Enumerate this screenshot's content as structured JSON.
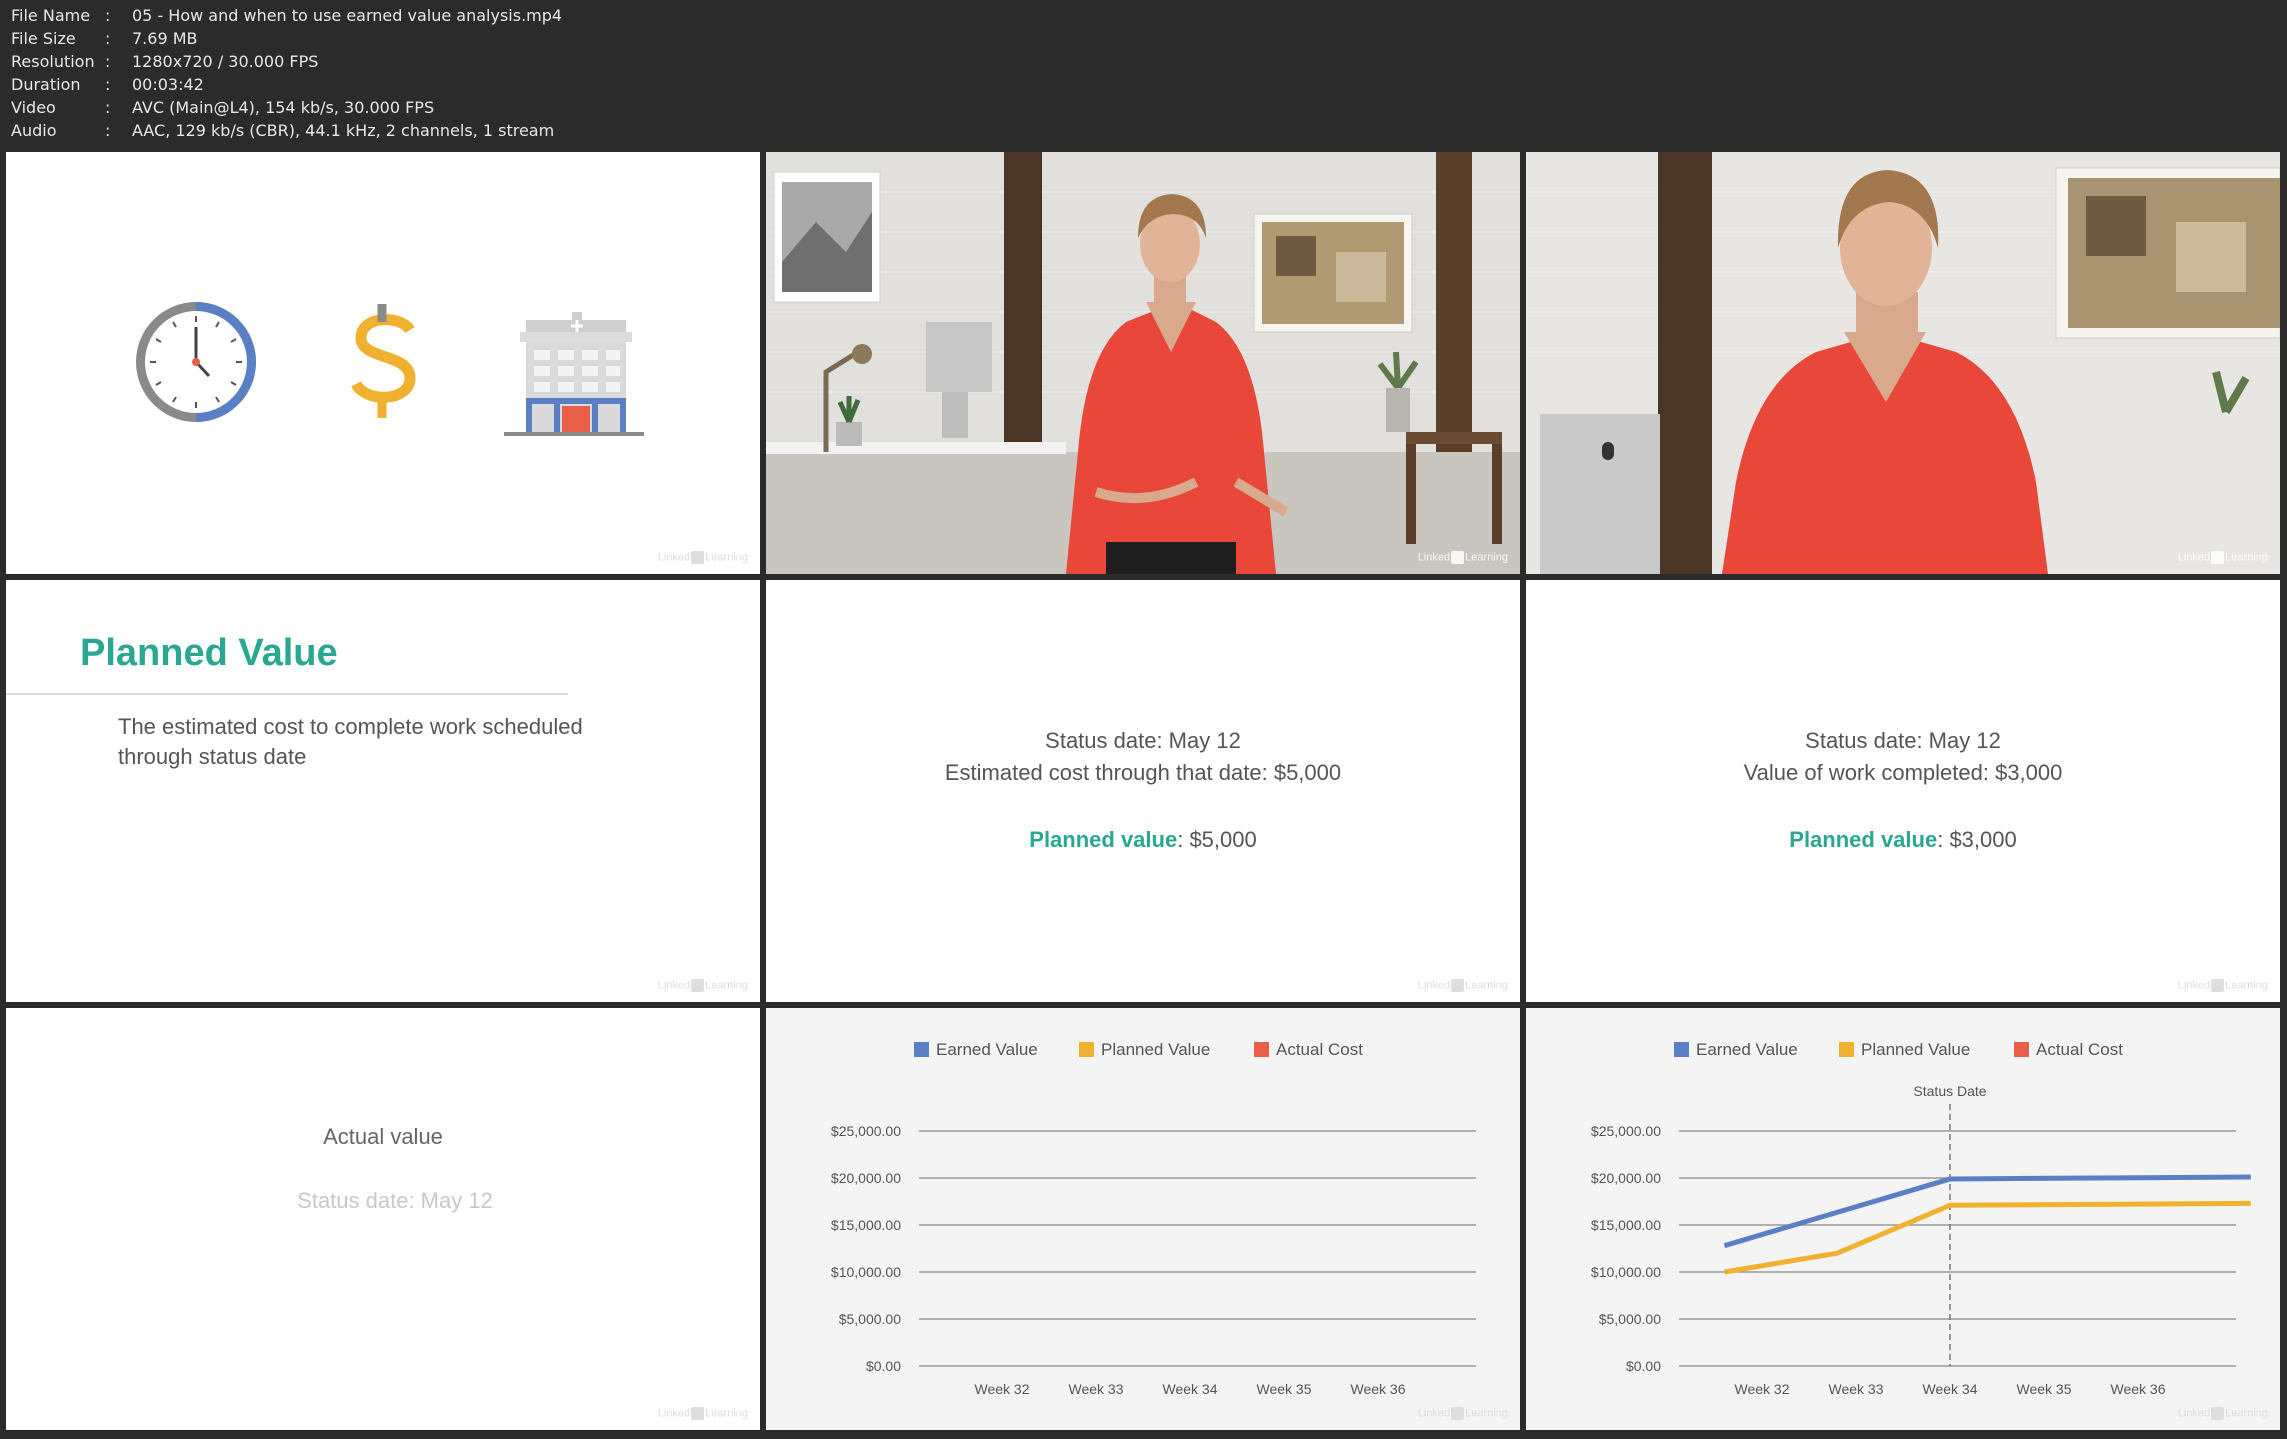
{
  "file_info": [
    {
      "key": "File Name",
      "value": "05 - How and when to use earned value analysis.mp4"
    },
    {
      "key": "File Size",
      "value": "7.69 MB"
    },
    {
      "key": "Resolution",
      "value": "1280x720 / 30.000 FPS"
    },
    {
      "key": "Duration",
      "value": "00:03:42"
    },
    {
      "key": "Video",
      "value": "AVC (Main@L4), 154 kb/s, 30.000 FPS"
    },
    {
      "key": "Audio",
      "value": "AAC, 129 kb/s (CBR), 44.1 kHz, 2 channels, 1 stream"
    }
  ],
  "watermark": {
    "pre": "Linked",
    "post": "Learning"
  },
  "colors": {
    "teal": "#2aa791",
    "earned": "#5b7fc4",
    "planned": "#f0b030",
    "actual": "#e8604a",
    "clock_ring": "#8a8a8a",
    "shirt": "#e8473a"
  },
  "icons": [
    "clock-icon",
    "dollar-icon",
    "building-icon"
  ],
  "slide_planned_value": {
    "title": "Planned Value",
    "body_line1": "The estimated cost to complete work scheduled",
    "body_line2": "through status date"
  },
  "slide_status_1": {
    "line1": "Status date: May 12",
    "line2": "Estimated cost through that date: $5,000",
    "label": "Planned value",
    "value": ": $5,000"
  },
  "slide_status_2": {
    "line1": "Status date: May 12",
    "line2": "Value of work completed: $3,000",
    "label": "Planned value",
    "value": ": $3,000"
  },
  "slide_actual": {
    "line1": "Actual value",
    "line2": "Status date: May 12"
  },
  "chart_data": [
    {
      "type": "line",
      "legend": [
        "Earned Value",
        "Planned Value",
        "Actual Cost"
      ],
      "categories": [
        "Week 32",
        "Week 33",
        "Week 34",
        "Week 35",
        "Week 36"
      ],
      "yticks": [
        "$0.00",
        "$5,000.00",
        "$10,000.00",
        "$15,000.00",
        "$20,000.00",
        "$25,000.00"
      ],
      "ylim": [
        0,
        25000
      ],
      "series": []
    },
    {
      "type": "line",
      "legend": [
        "Earned Value",
        "Planned Value",
        "Actual Cost"
      ],
      "annotation": "Status Date",
      "categories": [
        "Week 32",
        "Week 33",
        "Week 34",
        "Week 35",
        "Week 36"
      ],
      "yticks": [
        "$0.00",
        "$5,000.00",
        "$10,000.00",
        "$15,000.00",
        "$20,000.00",
        "$25,000.00"
      ],
      "ylim": [
        0,
        25000
      ],
      "x_start": 31.6,
      "x_end": 37.2,
      "status_week": 34,
      "series": [
        {
          "name": "Earned Value",
          "x": [
            31.6,
            34,
            37.2
          ],
          "values": [
            12800,
            19900,
            20100
          ]
        },
        {
          "name": "Planned Value",
          "x": [
            31.6,
            32.8,
            34,
            37.2
          ],
          "values": [
            10000,
            12000,
            17100,
            17300
          ]
        }
      ]
    }
  ]
}
